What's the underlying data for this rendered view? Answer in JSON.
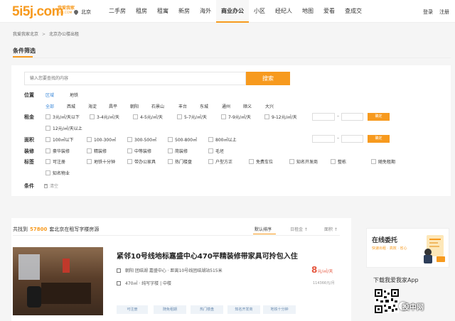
{
  "header": {
    "logo": "5i5j.com",
    "logo_sub": "我爱我家",
    "logo_sub2": "5I5J.COM",
    "city": "北京",
    "nav": [
      "二手房",
      "租房",
      "租寓",
      "新房",
      "海外",
      "商业办公",
      "小区",
      "经纪人",
      "地图",
      "爱看",
      "查成交"
    ],
    "active_nav": "商业办公",
    "login": "登录",
    "register": "注册"
  },
  "breadcrumb": [
    "我爱我家北京",
    "北京办公楼出租"
  ],
  "filter": {
    "title": "条件筛选",
    "search_placeholder": "输入您要查找的内容",
    "search_button": "搜索",
    "location": {
      "label": "位置",
      "tabs": [
        "区域",
        "地铁"
      ],
      "districts": [
        "全部",
        "西城",
        "海淀",
        "昌平",
        "朝阳",
        "石景山",
        "丰台",
        "东城",
        "通州",
        "顺义",
        "大兴"
      ]
    },
    "rent": {
      "label": "租金",
      "options": [
        "3元/㎡/天以下",
        "3-4元/㎡/天",
        "4-5元/㎡/天",
        "5-7元/㎡/天",
        "7-9元/㎡/天",
        "9-12元/㎡/天",
        "12元/㎡/天以上"
      ],
      "confirm": "确定"
    },
    "area": {
      "label": "面积",
      "options": [
        "100㎡以下",
        "100-300㎡",
        "300-500㎡",
        "500-800㎡",
        "800㎡以上"
      ],
      "confirm": "确定"
    },
    "decoration": {
      "label": "装修",
      "options": [
        "豪华装修",
        "精装修",
        "中等装修",
        "简装修",
        "毛坯"
      ]
    },
    "tags": {
      "label": "标签",
      "options": [
        "可注册",
        "地铁十分钟",
        "带办公家具",
        "热门楼盘",
        "户型方正",
        "免费车位",
        "知名开发商",
        "整栋",
        "随免租期",
        "知名物业"
      ]
    },
    "conditions": {
      "label": "条件",
      "clear": "清空"
    }
  },
  "results": {
    "prefix": "共找到",
    "count": "57800",
    "suffix": "套北京在租写字楼房源",
    "sort": [
      "默认排序",
      "日租金 ↑",
      "面积 ↑"
    ]
  },
  "listing": {
    "title": "紧邻10号线地标嘉盛中心470平精装修带家具可拎包入住",
    "location": "朝阳 团结湖 嘉盛中心 · 距离10号线团结湖站515米",
    "details": "470㎡ · 纯写字楼 | 中楼",
    "price": "8",
    "price_unit": "元/㎡/天",
    "price_sub": "114366元/月",
    "tags": [
      "可注册",
      "随免租期",
      "热门楼盘",
      "知名开发商",
      "地铁十分钟"
    ]
  },
  "sidebar": {
    "promo_title": "在线委托",
    "promo_sub": "快速出租 · 高效 · 省心",
    "app_title": "下载我爱我家App"
  },
  "watermark": "投中网",
  "colors": {
    "brand": "#f79a1e",
    "link": "#3a87d8",
    "price": "#e5573f"
  }
}
